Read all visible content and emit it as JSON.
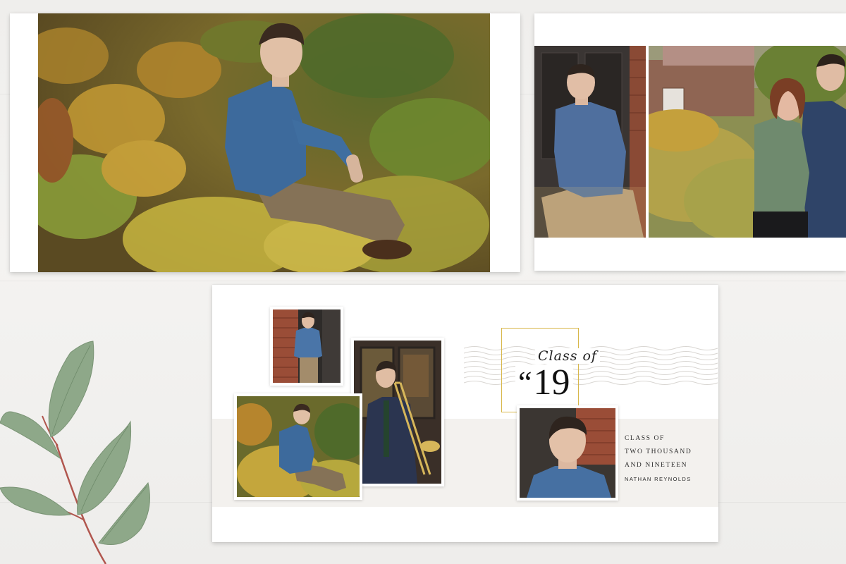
{
  "scene": {
    "background_color": "#f0efed",
    "accent_gold": "#d8b74a"
  },
  "spread_top_left": {
    "photo": "senior portrait sitting among autumn leaves"
  },
  "spread_top_right": {
    "photos": [
      "senior portrait by dark doorway",
      "senior with mother outdoors"
    ]
  },
  "spread_bottom": {
    "heading": {
      "class_of": "Class of",
      "quote": "“",
      "year": "19"
    },
    "info": {
      "line1": "CLASS OF",
      "line2": "TWO THOUSAND",
      "line3": "AND NINETEEN",
      "name": "NATHAN REYNOLDS"
    }
  },
  "decor": {
    "branch": "eucalyptus-branch-icon"
  }
}
